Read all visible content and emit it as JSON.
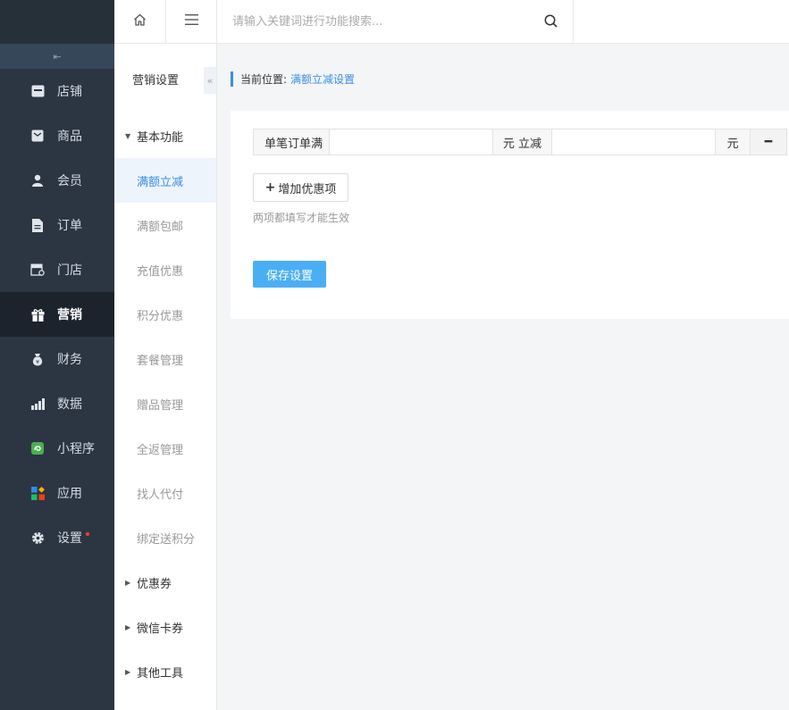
{
  "sidebar": {
    "collapse_glyph": "⇤",
    "items": [
      {
        "label": "店铺",
        "icon": "store-icon"
      },
      {
        "label": "商品",
        "icon": "product-icon"
      },
      {
        "label": "会员",
        "icon": "member-icon"
      },
      {
        "label": "订单",
        "icon": "order-icon"
      },
      {
        "label": "门店",
        "icon": "shop-icon"
      },
      {
        "label": "营销",
        "icon": "gift-icon",
        "active": true
      },
      {
        "label": "财务",
        "icon": "money-bag-icon"
      },
      {
        "label": "数据",
        "icon": "bar-chart-icon"
      },
      {
        "label": "小程序",
        "icon": "mini-program-icon"
      },
      {
        "label": "应用",
        "icon": "apps-icon"
      },
      {
        "label": "设置",
        "icon": "gear-icon",
        "badge_dot": true
      }
    ]
  },
  "topbar": {
    "search_placeholder": "请输入关键词进行功能搜索..."
  },
  "submenu": {
    "title": "营销设置",
    "collapse_glyph": "«",
    "group_basic": "基本功能",
    "basic_items": [
      "满额立减",
      "满额包邮",
      "充值优惠",
      "积分优惠",
      "套餐管理",
      "赠品管理",
      "全返管理",
      "找人代付",
      "绑定送积分"
    ],
    "active_index": 0,
    "group_coupon": "优惠券",
    "group_wechat_card": "微信卡券",
    "group_other": "其他工具"
  },
  "breadcrumb": {
    "label": "当前位置:",
    "current": "满额立减设置"
  },
  "form": {
    "row_label_left": "单笔订单满",
    "row_label_mid": "元 立减",
    "row_label_right": "元",
    "minus_glyph": "━",
    "order_threshold_value": "",
    "discount_value": "",
    "add_button": "增加优惠项",
    "hint": "两项都填写才能生效",
    "save_button": "保存设置"
  },
  "colors": {
    "sidebar_bg": "#2c3542",
    "accent": "#3a8ee6",
    "save_button": "#4aaef5"
  }
}
